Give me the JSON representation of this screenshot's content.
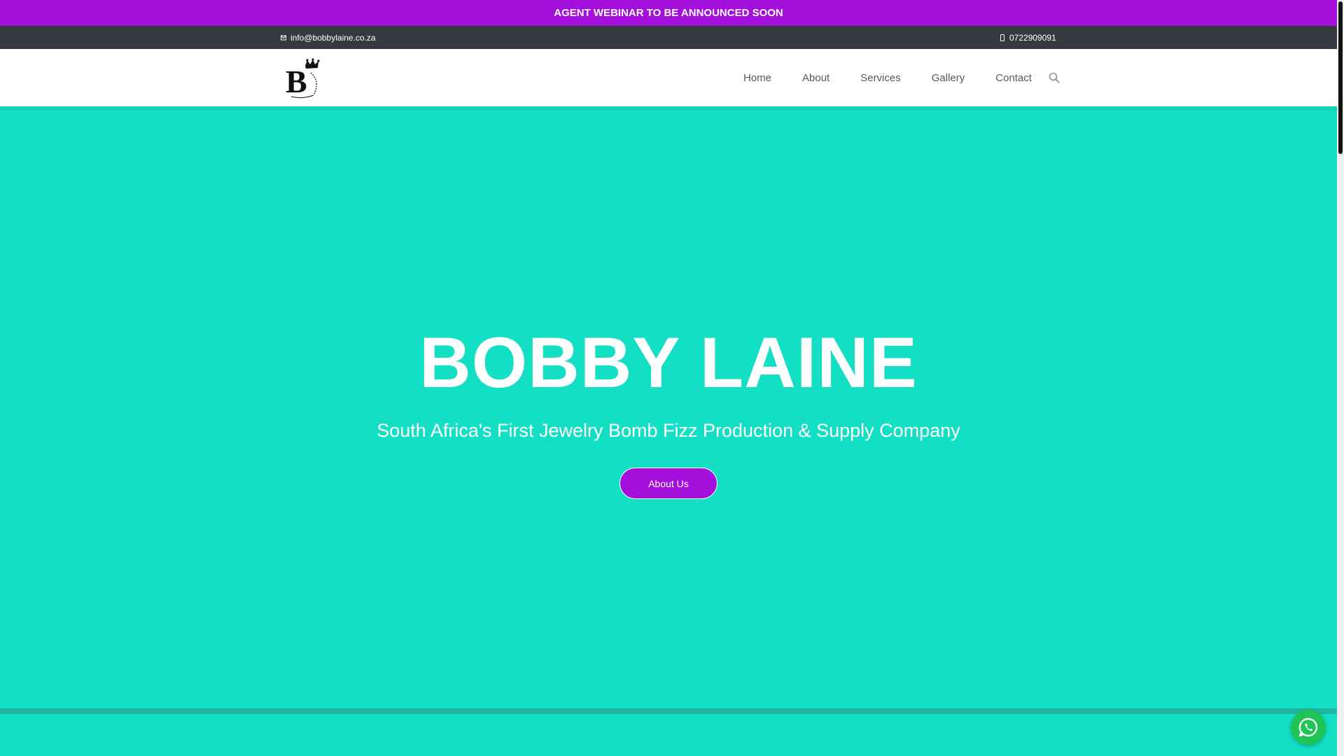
{
  "announcement": {
    "text": "AGENT WEBINAR TO BE ANNOUNCED SOON"
  },
  "topbar": {
    "email": "info@bobbylaine.co.za",
    "phone": "0722909091",
    "email_icon": "envelope-icon",
    "phone_icon": "phone-icon"
  },
  "header": {
    "logo_name": "bobby-laine-crown-b-logo",
    "nav": [
      {
        "label": "Home"
      },
      {
        "label": "About"
      },
      {
        "label": "Services"
      },
      {
        "label": "Gallery"
      },
      {
        "label": "Contact"
      }
    ],
    "search_icon": "search-icon"
  },
  "hero": {
    "title": "BOBBY LAINE",
    "subtitle": "South Africa's First Jewelry Bomb Fizz Production & Supply Company",
    "button_label": "About Us"
  },
  "floating": {
    "whatsapp_icon": "whatsapp-icon"
  },
  "colors": {
    "brand_purple": "#a50fdc",
    "hero_teal": "#13dfc4",
    "topbar_dark": "#363a40",
    "whatsapp_green": "#1ec454"
  }
}
